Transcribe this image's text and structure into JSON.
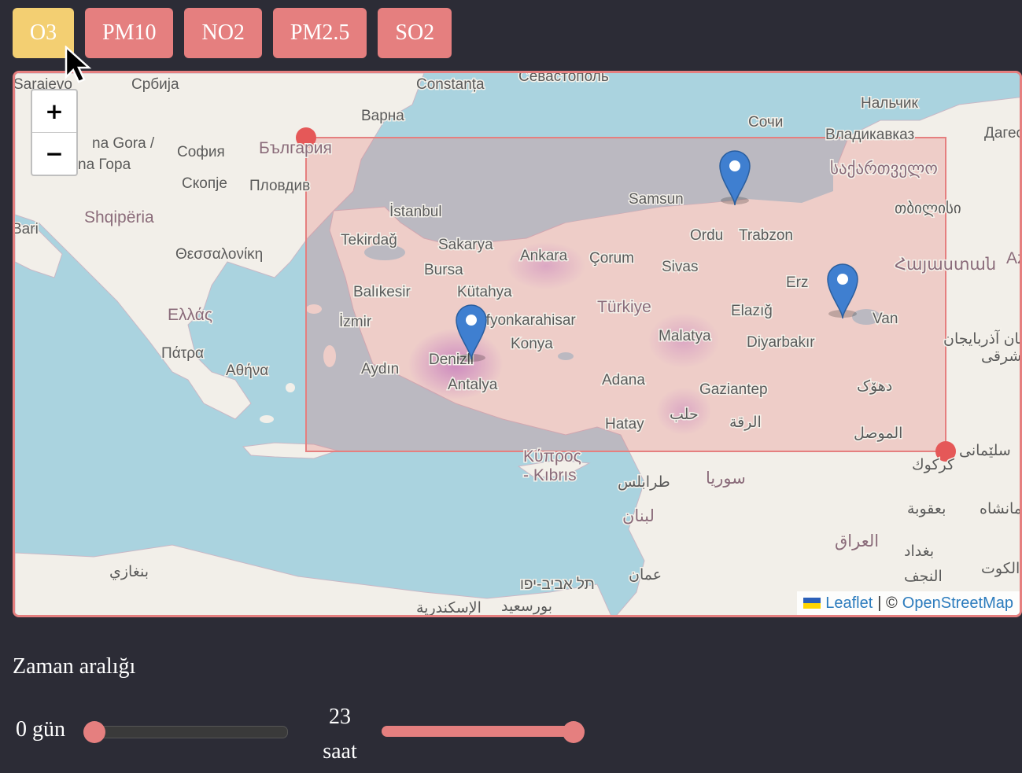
{
  "tabs": [
    {
      "label": "O3",
      "active": true
    },
    {
      "label": "PM10",
      "active": false
    },
    {
      "label": "NO2",
      "active": false
    },
    {
      "label": "PM2.5",
      "active": false
    },
    {
      "label": "SO2",
      "active": false
    }
  ],
  "map": {
    "zoom_in": "+",
    "zoom_out": "−",
    "attribution": {
      "leaflet": "Leaflet",
      "separator": "| ©",
      "osm": "OpenStreetMap"
    },
    "labels": {
      "sarajevo": "Sarajevo",
      "srbija": "Србија",
      "constanta": "Constanța",
      "sevastopol": "Севастополь",
      "nalchik": "Нальчик",
      "sochi": "Сочи",
      "varna": "Варна",
      "vladikavkaz": "Владикавказ",
      "dagestan": "Дагест",
      "crna_gora_1": "na Gora /",
      "crna_gora_2": "na Гора",
      "sofia": "София",
      "bulgaria": "България",
      "georgia": "საქართველო",
      "skopje": "Скопје",
      "plovdiv": "Пловдив",
      "samsun": "Samsun",
      "tbilisi": "თბილისი",
      "istanbul": "İstanbul",
      "shqiperia": "Shqipëria",
      "bari": "Bari",
      "tekirdag": "Tekirdağ",
      "sakarya": "Sakarya",
      "ordu": "Ordu",
      "trabzon": "Trabzon",
      "ankara": "Ankara",
      "corum": "Çorum",
      "thessaloniki": "Θεσσαλονίκη",
      "bursa": "Bursa",
      "sivas": "Sivas",
      "armenia": "Հայաստան",
      "az": "Az",
      "balikesir": "Balıkesir",
      "kutahya": "Kütahya",
      "erzurum": "Erz",
      "turkiye": "Türkiye",
      "ellada": "Ελλάς",
      "elazig": "Elazığ",
      "afyon": "Afyonkarahisar",
      "van": "Van",
      "izmir": "İzmir",
      "malatya": "Malatya",
      "azerbaijan_1": "تان آذربایجان",
      "azerbaijan_2": "شرقی",
      "patra": "Πάτρα",
      "konya": "Konya",
      "diyarbakir": "Diyarbakır",
      "athina": "Αθήνα",
      "aydin": "Aydın",
      "denizli": "Denizli",
      "antalya": "Antalya",
      "adana": "Adana",
      "dohuk": "دهۆک",
      "gaziantep": "Gaziantep",
      "halab": "حلب",
      "raqqa": "الرقة",
      "hatay": "Hatay",
      "mosul": "الموصل",
      "sulaymaniyah": "سلێمانی",
      "kypros": "Κύπρος",
      "kibris": "- Kıbrıs",
      "kirkuk": "كركوك",
      "tripoli": "طرابلس",
      "syria": "سوريا",
      "lebanon": "لبنان",
      "baqubah": "بعقوبة",
      "kermanshah": "کرمانشاه",
      "iraq": "العراق",
      "baghdad": "بغداد",
      "benghazi": "بنغازي",
      "amman": "عمان",
      "kuwait": "الكوت",
      "najaf": "النجف",
      "telaviv": "תל אביב-יפו",
      "portsaid": "بورسعيد",
      "alexandria": "الإسكندرية"
    }
  },
  "time": {
    "title": "Zaman aralığı",
    "days_label": "0 gün",
    "days_value": 0,
    "hours_value": "23",
    "hours_label": "saat",
    "hours_fill": 1.0
  },
  "colors": {
    "accent": "#e57f7f",
    "active_tab": "#f3cf72",
    "background": "#2c2c36",
    "marker": "#3f7fd0"
  }
}
